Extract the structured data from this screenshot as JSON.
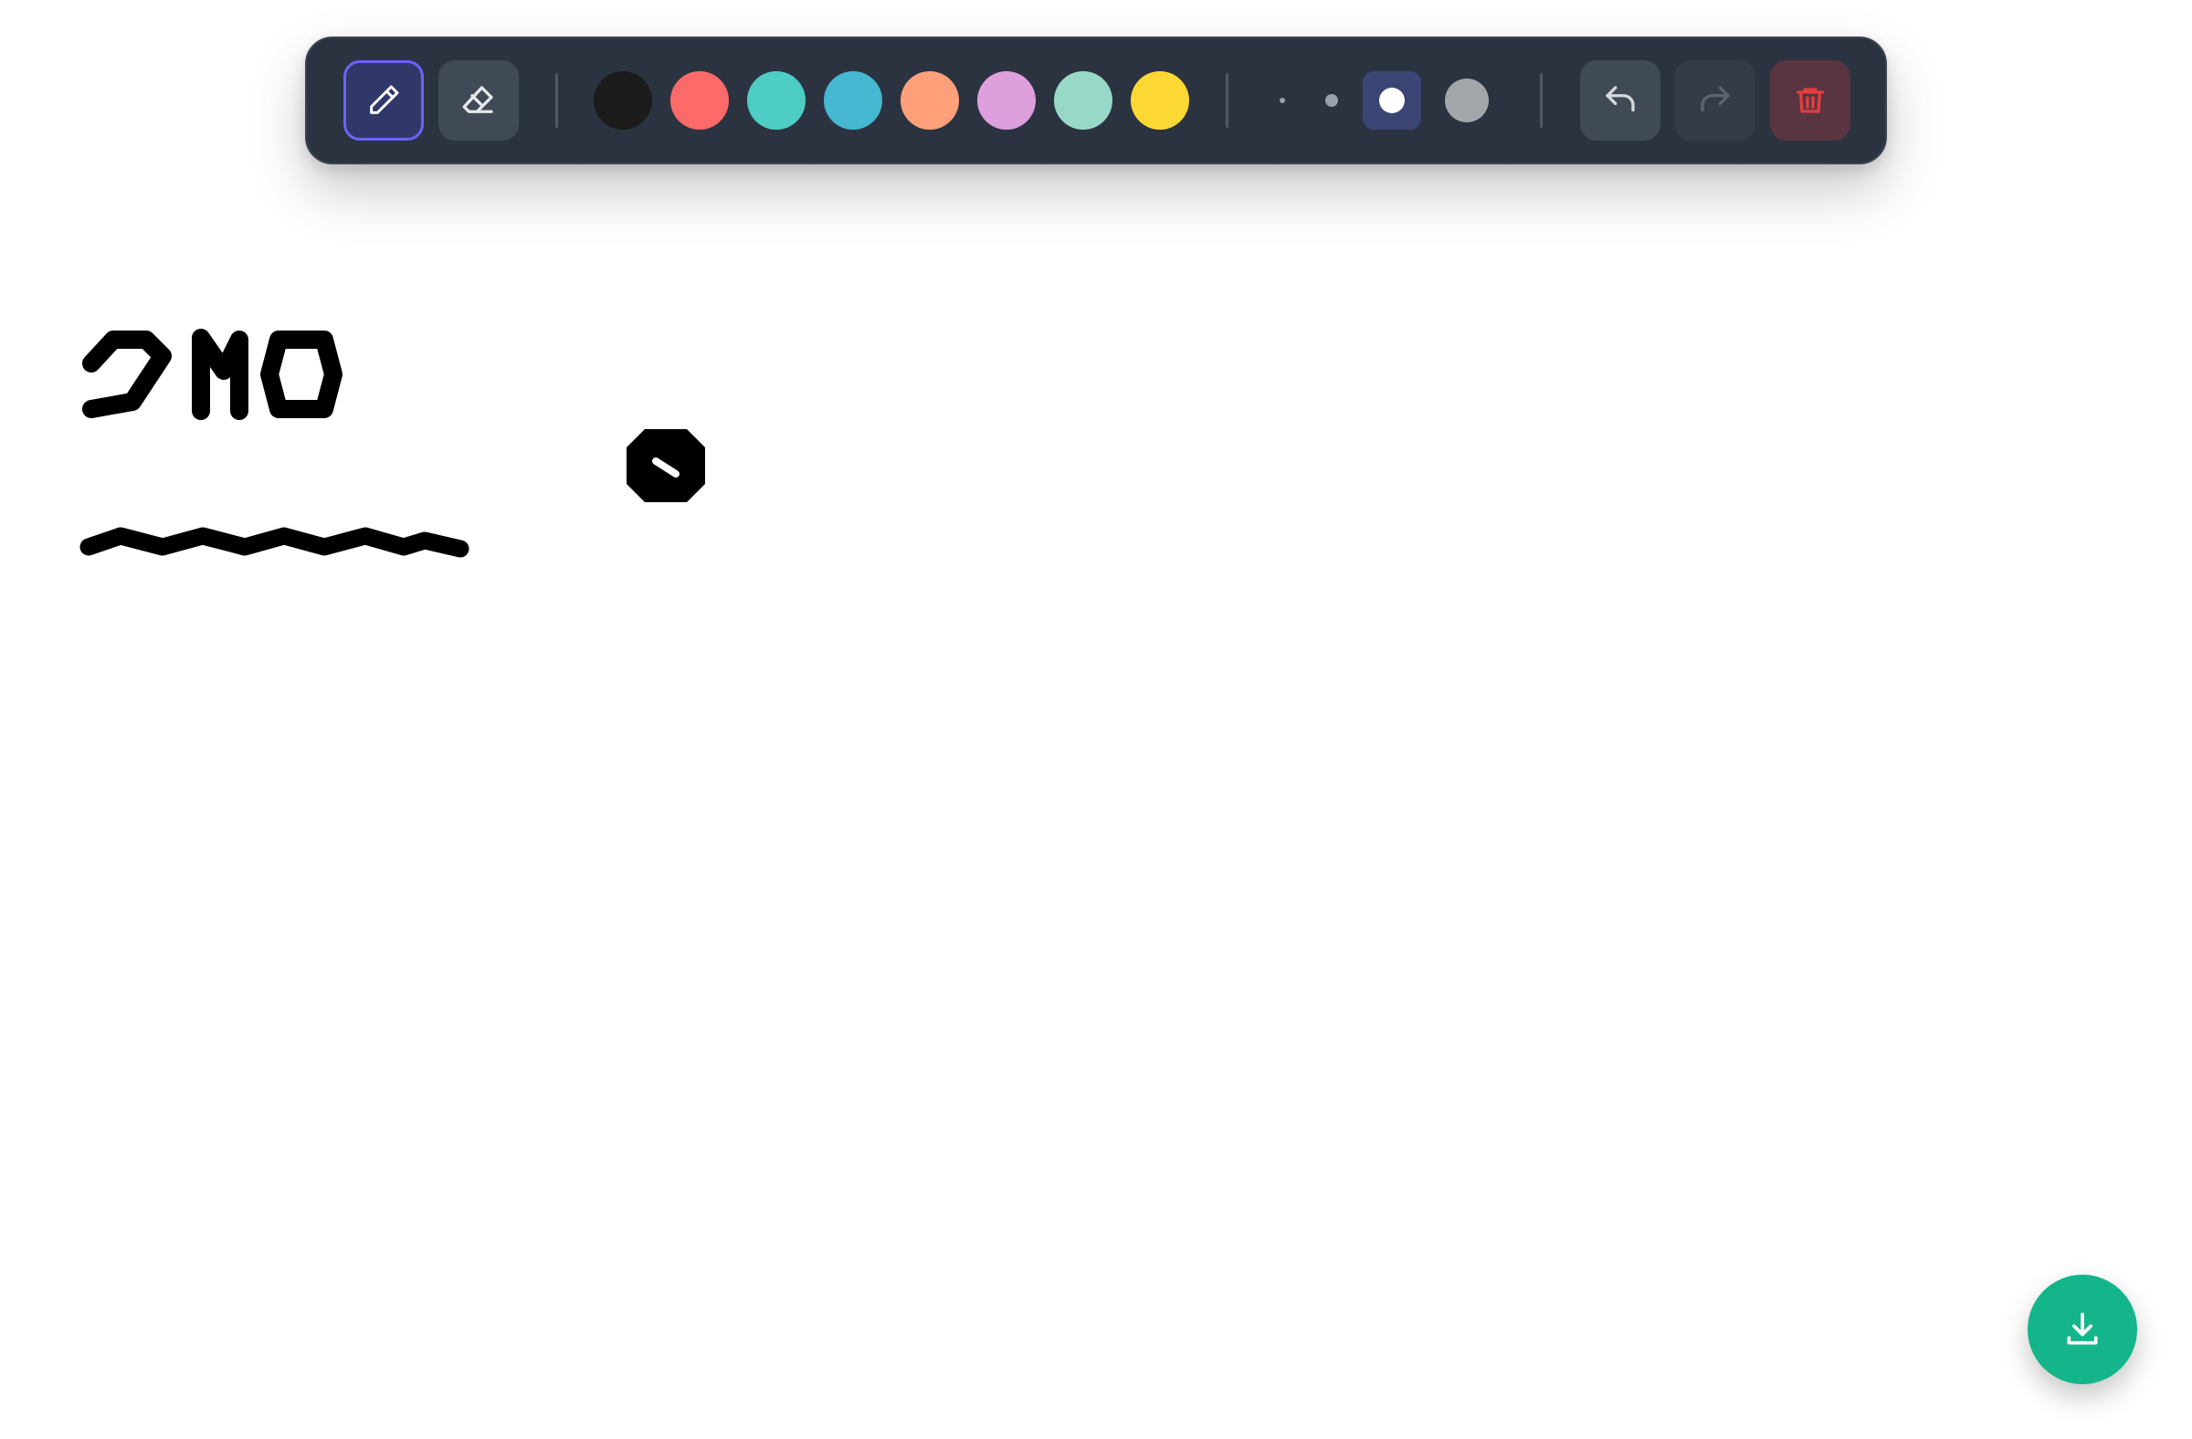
{
  "toolbar": {
    "tools": [
      {
        "name": "pencil",
        "icon": "pencil-icon",
        "active": true
      },
      {
        "name": "eraser",
        "icon": "eraser-icon",
        "active": false
      }
    ],
    "colors": [
      {
        "hex": "#1c1c1c",
        "selected": true
      },
      {
        "hex": "#fd6a6a",
        "selected": false
      },
      {
        "hex": "#4ecdc4",
        "selected": false
      },
      {
        "hex": "#45b7d1",
        "selected": false
      },
      {
        "hex": "#ffa07a",
        "selected": false
      },
      {
        "hex": "#dda0dd",
        "selected": false
      },
      {
        "hex": "#98d8c8",
        "selected": false
      },
      {
        "hex": "#fdd835",
        "selected": false
      }
    ],
    "brush_sizes": [
      {
        "level": 1,
        "selected": false
      },
      {
        "level": 2,
        "selected": false
      },
      {
        "level": 3,
        "selected": true
      },
      {
        "level": 4,
        "selected": false
      }
    ],
    "history": {
      "undo": {
        "icon": "undo-icon",
        "enabled": true
      },
      "redo": {
        "icon": "redo-icon",
        "enabled": false
      },
      "clear": {
        "icon": "trash-icon",
        "color": "#e53e3e"
      }
    }
  },
  "canvas": {
    "stroke_color": "#000000",
    "strokes": [
      "handwritten-glyphs",
      "stop-sign-scribble",
      "wavy-line"
    ]
  },
  "download": {
    "icon": "download-icon",
    "color": "#14b58a"
  }
}
